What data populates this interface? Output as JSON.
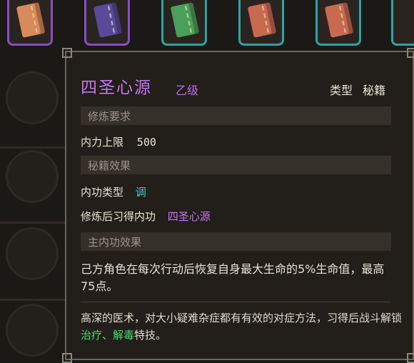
{
  "inventory": {
    "books": [
      {
        "color": "#d98a5a",
        "border": "#8a4cc4"
      },
      {
        "color": "#5a4a9a",
        "border": "#8a4cc4"
      },
      {
        "color": "#4aa05a",
        "border": "#2ea3a3"
      },
      {
        "color": "#c86a50",
        "border": "#2ea3a3"
      },
      {
        "color": "#c86a50",
        "border": "#2ea3a3"
      }
    ]
  },
  "item": {
    "name": "四圣心源",
    "grade": "乙级",
    "type_label": "类型",
    "type_value": "秘籍"
  },
  "sections": {
    "requirement_header": "修炼要求",
    "req_label": "内力上限",
    "req_value": "500",
    "effect_header": "秘籍效果",
    "inner_type_label": "内功类型",
    "inner_type_value": "调",
    "learn_label": "修炼后习得内功",
    "learn_value": "四圣心源",
    "main_header": "主内功效果",
    "main_effect": "己方角色在每次行动后恢复自身最大生命的5%生命值，最高75点。",
    "desc_prefix": "高深的医术，对大小疑难杂症都有有效的对症方法，习得后战斗解锁",
    "skill1": "治疗",
    "desc_sep": "、",
    "skill2": "解毒",
    "desc_suffix": "特技。"
  },
  "colors": {
    "title": "#c276f0",
    "cyan": "#3fd0c0",
    "green": "#3fe070"
  }
}
